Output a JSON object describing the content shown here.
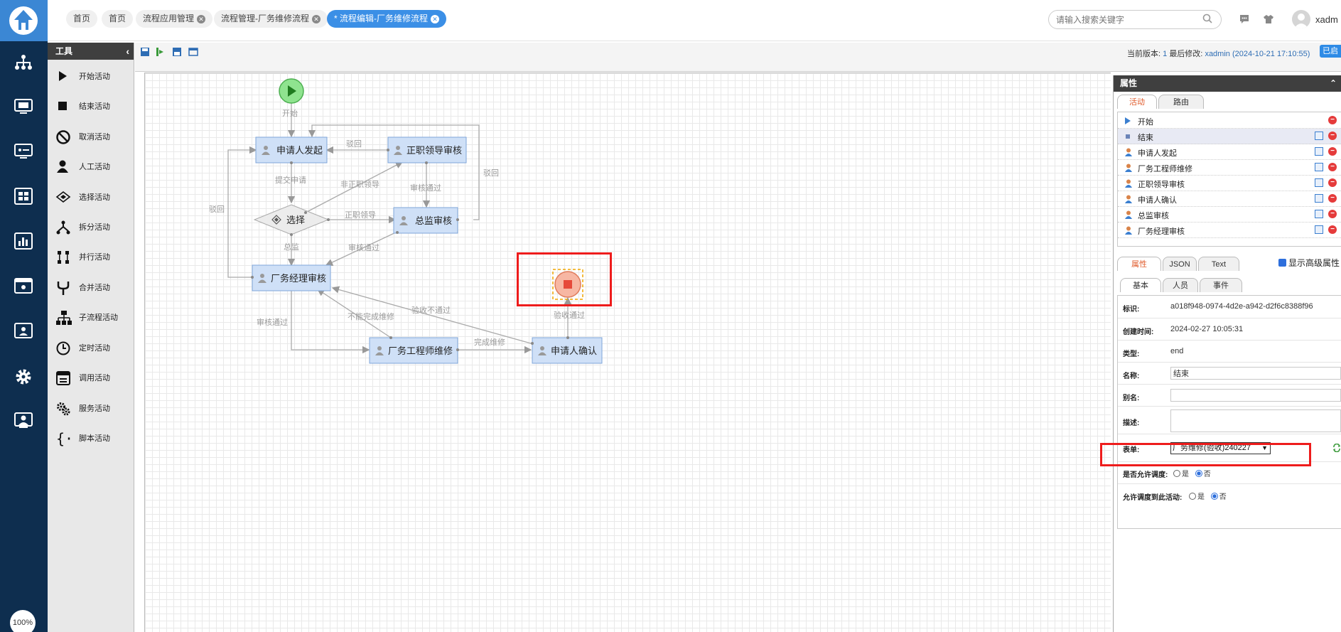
{
  "sidebar": {
    "zoom": "100%"
  },
  "tabs": [
    {
      "label": "首页"
    },
    {
      "label": "首页"
    },
    {
      "label": "流程应用管理"
    },
    {
      "label": "流程管理-厂务维修流程"
    },
    {
      "label": "* 流程编辑-厂务维修流程"
    }
  ],
  "header": {
    "search_placeholder": "请输入搜索关键字",
    "username": "xadm"
  },
  "tools": {
    "title": "工具",
    "items": [
      "开始活动",
      "结束活动",
      "取消活动",
      "人工活动",
      "选择活动",
      "拆分活动",
      "并行活动",
      "合并活动",
      "子流程活动",
      "定时活动",
      "调用活动",
      "服务活动",
      "脚本活动"
    ]
  },
  "toolbar": {
    "version_label": "当前版本:",
    "version": "1",
    "modified_label": "最后修改:",
    "modified_by": "xadmin (2024-10-21 17:10:55)",
    "enabled_label": "已启"
  },
  "diagram": {
    "nodes": {
      "start": "",
      "applicant_start": "申请人发起",
      "leader_review": "正职领导审核",
      "choice": "选择",
      "director_review": "总监审核",
      "manager_review": "厂务经理审核",
      "engineer_repair": "厂务工程师维修",
      "applicant_confirm": "申请人确认"
    },
    "edge_labels": {
      "start": "开始",
      "reject1": "驳回",
      "submit": "提交申请",
      "non_leader": "非正职领导",
      "review_pass1": "审核通过",
      "reject2": "驳回",
      "leader": "正职领导",
      "reject3": "驳回",
      "director": "总监",
      "review_pass2": "审核通过",
      "review_pass3": "审核通过",
      "not_complete": "不能完成维修",
      "check_fail": "验收不通过",
      "check_pass": "验收通过",
      "repair_done": "完成维修"
    }
  },
  "props": {
    "title": "属性",
    "list_tabs": [
      "活动",
      "路由"
    ],
    "activities": [
      {
        "label": "开始",
        "type": "start"
      },
      {
        "label": "结束",
        "type": "end"
      },
      {
        "label": "申请人发起",
        "type": "user"
      },
      {
        "label": "厂务工程师维修",
        "type": "user"
      },
      {
        "label": "正职领导审核",
        "type": "user"
      },
      {
        "label": "申请人确认",
        "type": "user"
      },
      {
        "label": "总监审核",
        "type": "user"
      },
      {
        "label": "厂务经理审核",
        "type": "user"
      }
    ],
    "detail_tabs": [
      "属性",
      "JSON",
      "Text"
    ],
    "advanced_label": "显示高级属性",
    "sub_tabs": [
      "基本",
      "人员",
      "事件"
    ],
    "fields": {
      "id_label": "标识:",
      "id_value": "a018f948-0974-4d2e-a942-d2f6c8388f96",
      "created_label": "创建时间:",
      "created_value": "2024-02-27 10:05:31",
      "type_label": "类型:",
      "type_value": "end",
      "name_label": "名称:",
      "name_value": "结束",
      "alias_label": "别名:",
      "alias_value": "",
      "desc_label": "描述:",
      "form_label": "表单:",
      "form_value": "厂务维修(验收)240227",
      "dispatch_label": "是否允许调度:",
      "dispatch_to_label": "允许调度到此活动:",
      "yes": "是",
      "no": "否"
    }
  }
}
